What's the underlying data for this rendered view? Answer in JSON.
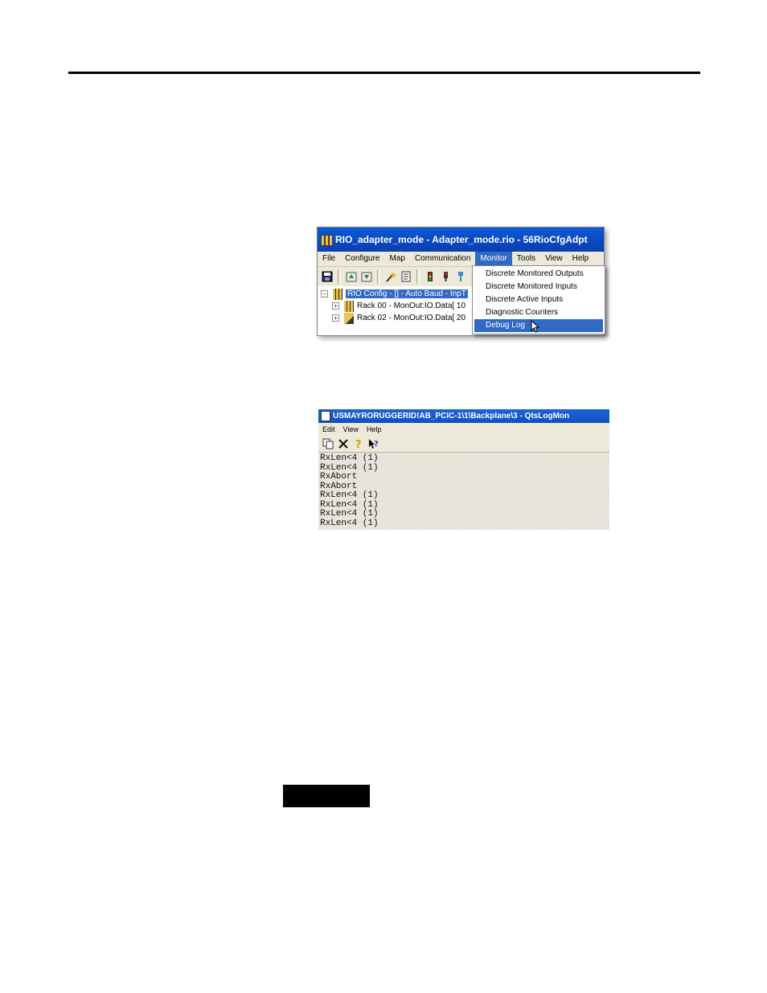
{
  "screenshot1": {
    "title": "RIO_adapter_mode - Adapter_mode.rio - 56RioCfgAdpt",
    "menu": [
      "File",
      "Configure",
      "Map",
      "Communication",
      "Monitor",
      "Tools",
      "View",
      "Help"
    ],
    "active_menu": "Monitor",
    "tree": {
      "root": "RIO Config - [] - Auto Baud - InpT",
      "children": [
        "Rack 00 - MonOut:IO.Data[ 10",
        "Rack 02 - MonOut:IO.Data[ 20"
      ]
    },
    "dropdown": {
      "items": [
        "Discrete Monitored Outputs",
        "Discrete Monitored Inputs",
        "Discrete Active Inputs",
        "Diagnostic Counters",
        "Debug Log"
      ],
      "highlighted": "Debug Log"
    }
  },
  "screenshot2": {
    "title": "USMAYRORUGGERID!AB_PCIC-1\\1\\Backplane\\3 - QtsLogMon",
    "menu": [
      "Edit",
      "View",
      "Help"
    ],
    "log_lines": [
      "RxLen<4 (1)",
      "RxLen<4 (1)",
      "RxAbort",
      "RxAbort",
      "RxLen<4 (1)",
      "RxLen<4 (1)",
      "RxLen<4 (1)",
      "RxLen<4 (1)"
    ]
  },
  "colors": {
    "selection": "#316ac5",
    "titlebar": "#0b47c2",
    "face": "#ece9d8"
  }
}
